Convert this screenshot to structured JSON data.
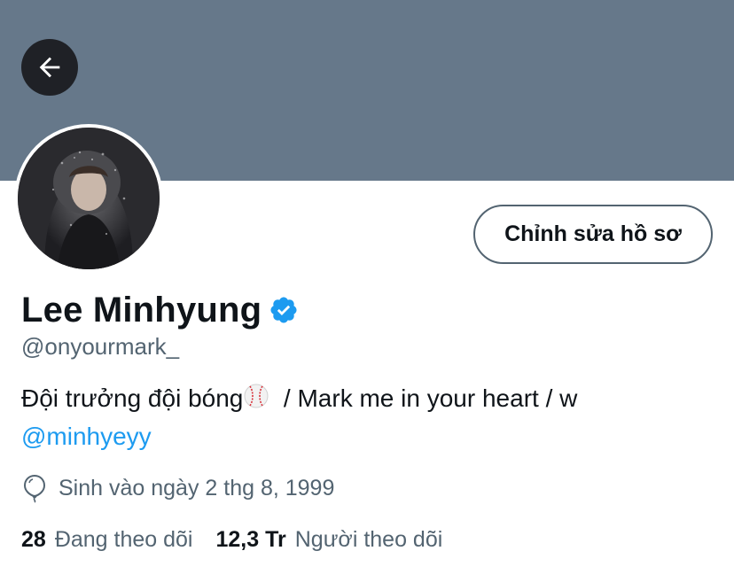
{
  "profile": {
    "banner_color": "#66788a",
    "display_name": "Lee Minhyung",
    "handle": "@onyourmark_",
    "verified": true,
    "bio": {
      "text_before": "Đội trưởng đội bóng",
      "emoji": "baseball-icon",
      "text_after": "  / Mark me in your heart / w",
      "mention": "@minhyeyy"
    },
    "birthday": "Sinh vào ngày 2 thg 8, 1999"
  },
  "actions": {
    "edit_profile_label": "Chỉnh sửa hồ sơ"
  },
  "stats": {
    "following_count": "28",
    "following_label": "Đang theo dõi",
    "followers_count": "12,3 Tr",
    "followers_label": "Người theo dõi"
  },
  "colors": {
    "accent": "#1d9bf0",
    "secondary_text": "#536471",
    "primary_text": "#0f1419"
  }
}
